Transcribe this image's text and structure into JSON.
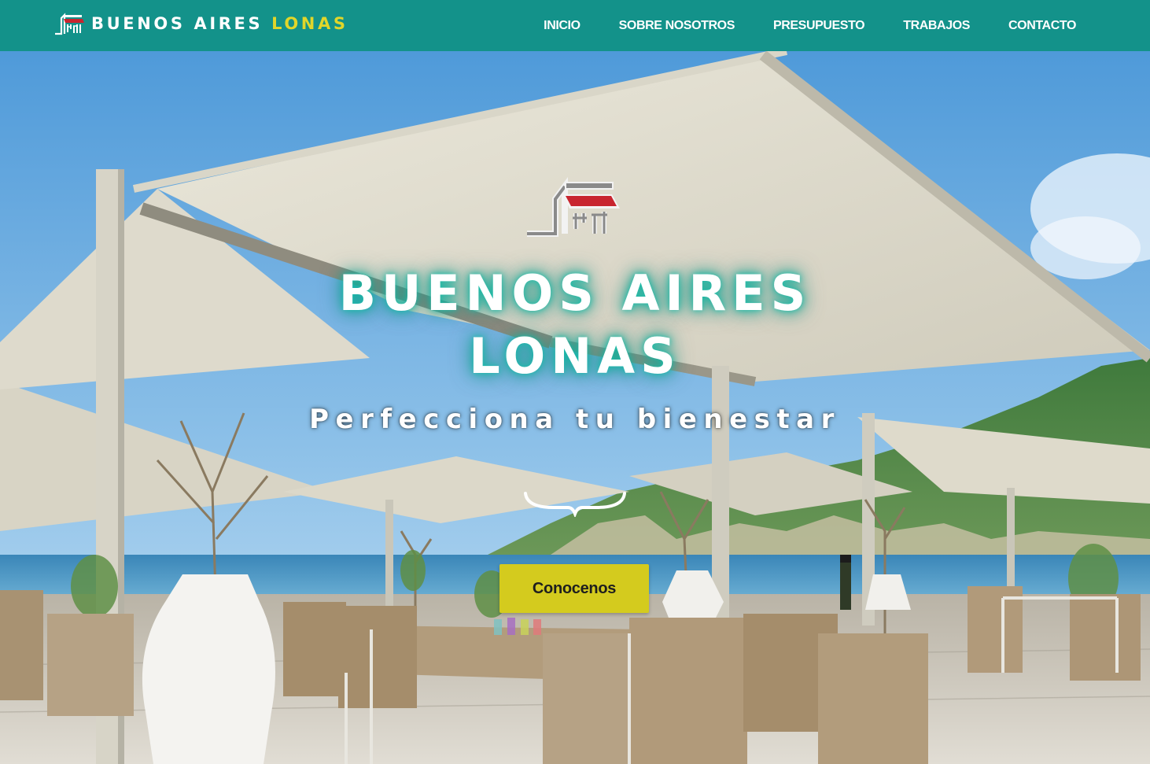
{
  "header": {
    "brand": {
      "name_part1": "BUENOS AIRES",
      "name_part2": "LONAS",
      "logo_icon": "awning-store-icon"
    },
    "nav": [
      {
        "label": "INICIO"
      },
      {
        "label": "SOBRE NOSOTROS"
      },
      {
        "label": "PRESUPUESTO"
      },
      {
        "label": "TRABAJOS"
      },
      {
        "label": "CONTACTO"
      }
    ]
  },
  "hero": {
    "logo_icon": "awning-store-icon",
    "title_line1": "BUENOS AIRES",
    "title_line2": "LONAS",
    "subtitle": "Perfecciona tu bienestar",
    "divider_icon": "curly-brace-divider-icon",
    "cta_label": "Conocenos",
    "background": "terrace-with-retractable-awnings-photo"
  },
  "colors": {
    "nav_bg": "#13928a",
    "brand_accent": "#e0d62a",
    "cta_bg": "#d4cb1e",
    "logo_red": "#c8252f",
    "title_glow": "#14beaa"
  }
}
